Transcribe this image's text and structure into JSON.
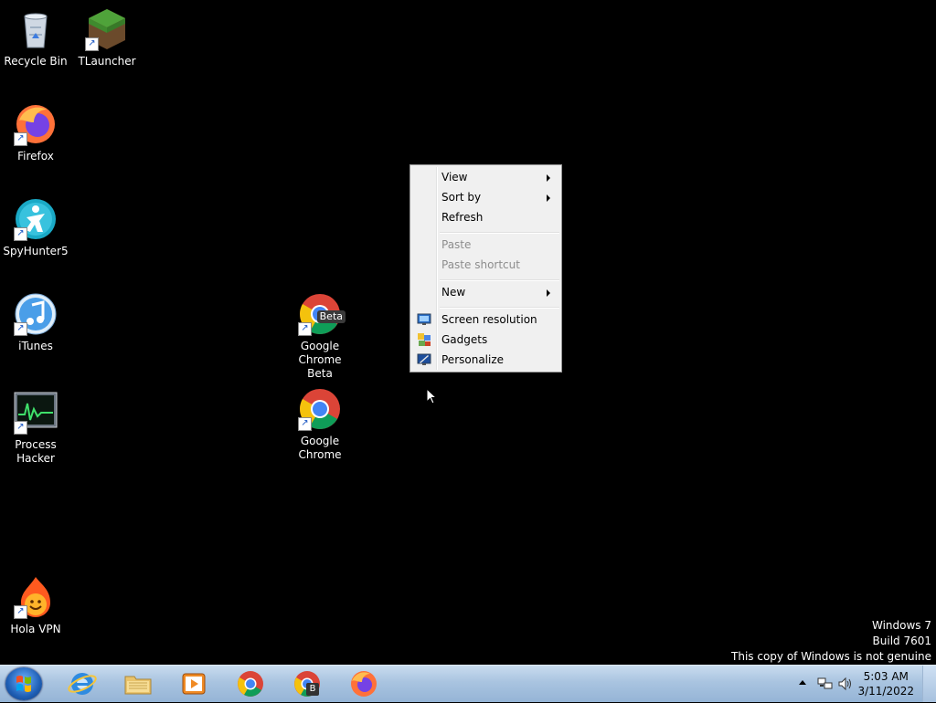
{
  "desktop_icons": {
    "recycle_bin": "Recycle Bin",
    "tlauncher": "TLauncher",
    "firefox": "Firefox",
    "spyhunter": "SpyHunter5",
    "itunes": "iTunes",
    "process_hacker_1": "Process",
    "process_hacker_2": "Hacker",
    "hola_vpn": "Hola VPN",
    "chrome_beta_1": "Google",
    "chrome_beta_2": "Chrome Beta",
    "chrome_beta_badge": "Beta",
    "chrome_1": "Google",
    "chrome_2": "Chrome"
  },
  "context_menu": {
    "view": "View",
    "sort_by": "Sort by",
    "refresh": "Refresh",
    "paste": "Paste",
    "paste_shortcut": "Paste shortcut",
    "new": "New",
    "screen_resolution": "Screen resolution",
    "gadgets": "Gadgets",
    "personalize": "Personalize"
  },
  "watermark": {
    "line1": "Windows 7",
    "line2": "Build 7601",
    "line3": "This copy of Windows is not genuine"
  },
  "taskbar": {
    "beta_letter": "B"
  },
  "clock": {
    "time": "5:03 AM",
    "date": "3/11/2022"
  }
}
